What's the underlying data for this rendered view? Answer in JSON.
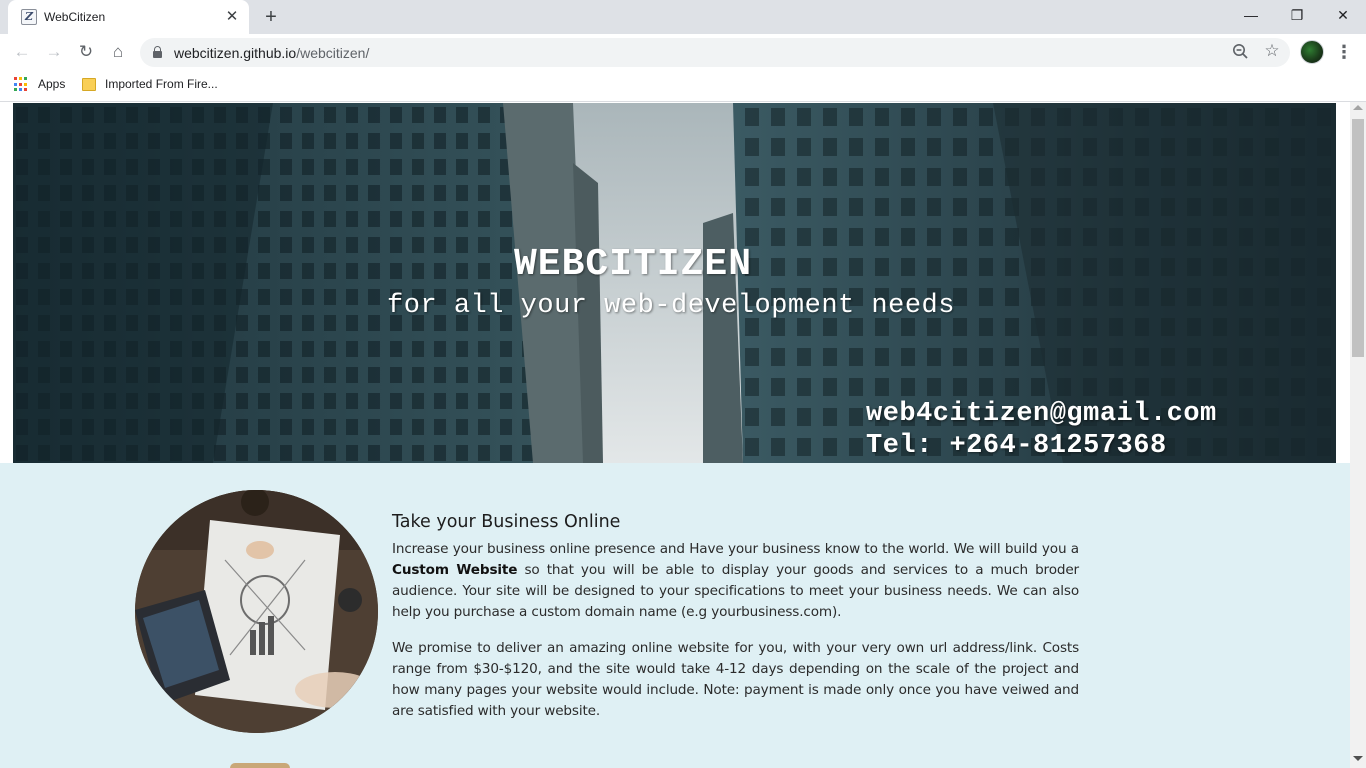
{
  "browser": {
    "tab": {
      "title": "WebCitizen",
      "favicon": "Z",
      "close_glyph": "✕"
    },
    "new_tab_glyph": "+",
    "window_controls": {
      "minimize": "—",
      "maximize": "❐",
      "close": "✕"
    },
    "nav": {
      "back": "←",
      "forward": "→",
      "reload": "↻",
      "home": "⌂"
    },
    "address": {
      "host": "webcitizen.github.io",
      "path": "/webcitizen/"
    },
    "star_glyph": "☆",
    "menu_glyph": "⋮",
    "bookmarks": [
      {
        "label": "Apps",
        "icon": "apps-grid-icon"
      },
      {
        "label": "Imported From Fire...",
        "icon": "folder-icon"
      }
    ],
    "apps_colors": [
      "#ea4335",
      "#fbbc05",
      "#34a853",
      "#4285f4",
      "#ea4335",
      "#fbbc05",
      "#34a853",
      "#4285f4",
      "#ea4335"
    ]
  },
  "hero": {
    "title": "WEBCITIZEN",
    "tagline": "for all your web-development needs",
    "email": "web4citizen@gmail.com",
    "tel": "Tel: +264-81257368"
  },
  "section": {
    "heading": "Take your Business Online",
    "p1_before": "Increase your business online presence and Have your business know to the world. We will build you a ",
    "p1_bold": "Custom Website",
    "p1_after": " so that you will be able to display your goods and services to a much broder audience. Your site will be designed to your specifications to meet your business needs. We can also help you purchase a custom domain name (e.g yourbusiness.com).",
    "p2": "We promise to deliver an amazing online website for you, with your very own url address/link. Costs range from $30-$120, and the site would take 4-12 days depending on the scale of the project and how many pages your website would include. Note: payment is made only once you have veiwed and are satisfied with your website."
  },
  "colors": {
    "content_bg": "#dff0f4",
    "hero_tint": "#2c4750",
    "tabstrip": "#dee1e6"
  }
}
